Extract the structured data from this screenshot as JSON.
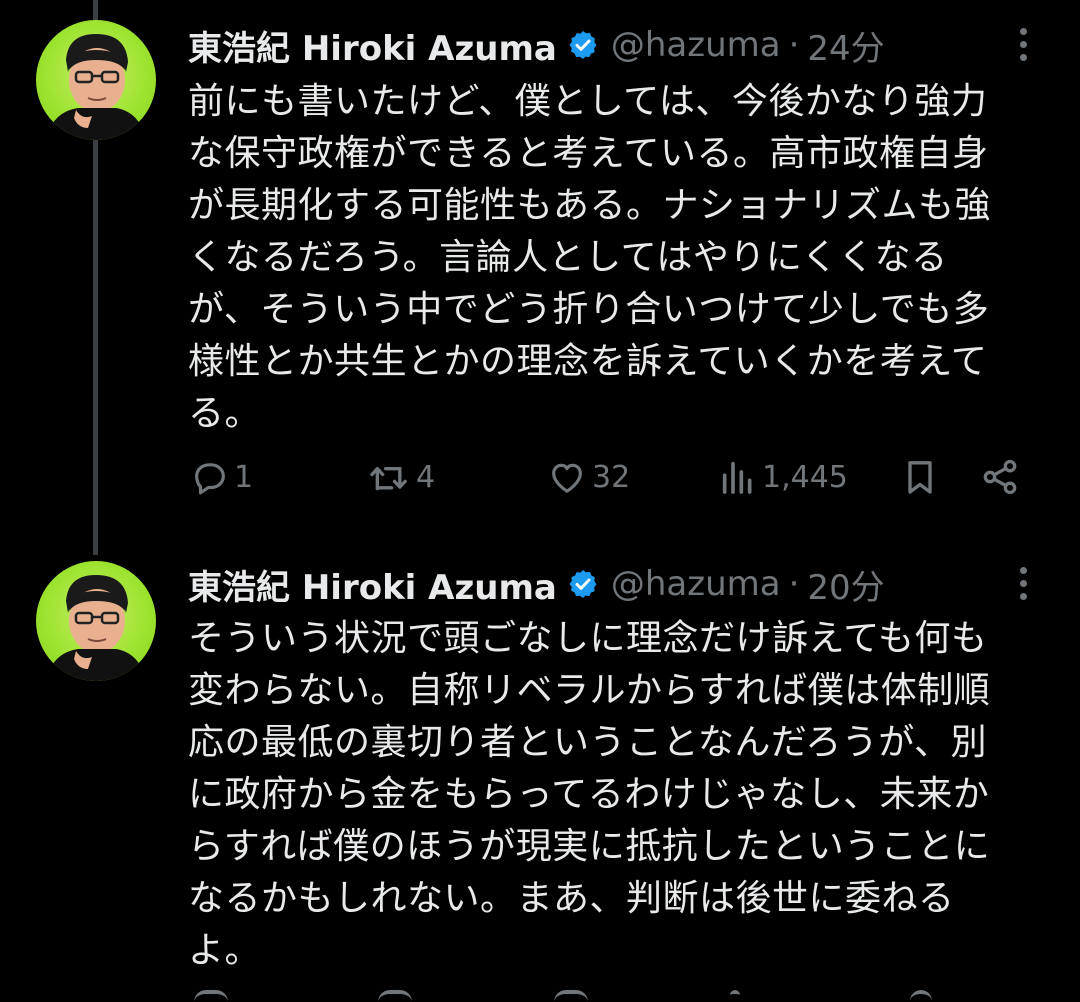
{
  "tweets": [
    {
      "display_name": "東浩紀 Hiroki Azuma",
      "handle": "@hazuma",
      "separator": "·",
      "time": "24分",
      "text": "前にも書いたけど、僕としては、今後かなり強力\nな保守政権ができると考えている。高市政権自身\nが長期化する可能性もある。ナショナリズムも強\nくなるだろう。言論人としてはやりにくくなる\nが、そういう中でどう折り合いつけて少しでも多\n様性とか共生とかの理念を訴えていくかを考えて\nる。",
      "replies": "1",
      "reposts": "4",
      "likes": "32",
      "views": "1,445"
    },
    {
      "display_name": "東浩紀 Hiroki Azuma",
      "handle": "@hazuma",
      "separator": "·",
      "time": "20分",
      "text": "そういう状況で頭ごなしに理念だけ訴えても何も\n変わらない。自称リベラルからすれば僕は体制順\n応の最低の裏切り者ということなんだろうが、別\nに政府から金をもらってるわけじゃなし、未来か\nらすれば僕のほうが現実に抵抗したということに\nなるかもしれない。まあ、判断は後世に委ねる\nよ。"
    }
  ],
  "icons": {
    "verified": "verified-badge-icon",
    "more": "more-vertical-icon",
    "reply": "reply-icon",
    "repost": "repost-icon",
    "like": "heart-icon",
    "views": "views-icon",
    "bookmark": "bookmark-icon",
    "share": "share-icon"
  },
  "colors": {
    "background": "#000000",
    "text": "#e7e9ea",
    "muted": "#71767b",
    "verified": "#1d9bf0",
    "avatar_bg": "#9be22d"
  }
}
